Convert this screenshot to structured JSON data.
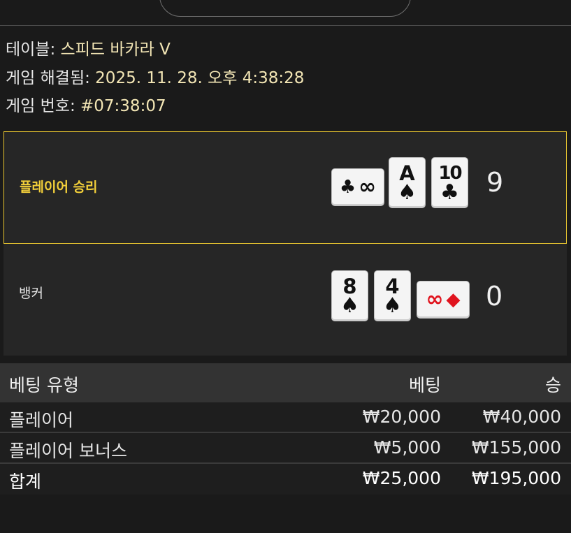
{
  "info": {
    "table_label": "테이블: ",
    "table_value": "스피드 바카라 V",
    "resolved_label": "게임 해결됨: ",
    "resolved_value": "2025. 11. 28. 오후 4:38:28",
    "game_no_label": "게임 번호: ",
    "game_no_value": "#07:38:07"
  },
  "player": {
    "label": "플레이어 승리",
    "score": "9",
    "cards": [
      {
        "rank": "",
        "suit_icon": "club-icon",
        "suit": "♣",
        "orientation": "sideways",
        "color": "#111111"
      },
      {
        "rank": "A",
        "suit_icon": "spade-icon",
        "suit": "♠",
        "orientation": "upright",
        "color": "#111111"
      },
      {
        "rank": "10",
        "suit_icon": "club-icon",
        "suit": "♣",
        "orientation": "upright",
        "color": "#111111"
      }
    ]
  },
  "banker": {
    "label": "뱅커",
    "score": "0",
    "cards": [
      {
        "rank": "8",
        "suit_icon": "spade-icon",
        "suit": "♠",
        "orientation": "upright",
        "color": "#111111"
      },
      {
        "rank": "4",
        "suit_icon": "spade-icon",
        "suit": "♠",
        "orientation": "upright",
        "color": "#111111"
      },
      {
        "rank": "",
        "suit_icon": "diamond-icon",
        "suit": "◆",
        "orientation": "sideways",
        "color": "#e0141e"
      }
    ]
  },
  "infinity_glyph": "∞",
  "bets": {
    "headers": {
      "type": "베팅 유형",
      "bet": "베팅",
      "win": "승"
    },
    "rows": [
      {
        "type": "플레이어",
        "bet": "₩20,000",
        "win": "₩40,000"
      },
      {
        "type": "플레이어 보너스",
        "bet": "₩5,000",
        "win": "₩155,000"
      }
    ],
    "total": {
      "type": "합계",
      "bet": "₩25,000",
      "win": "₩195,000"
    }
  },
  "colors": {
    "accent_gold": "#e8c530",
    "value_cream": "#f3e6b5",
    "background": "#1a1a1a",
    "panel": "#262626",
    "red_suit": "#e0141e"
  }
}
